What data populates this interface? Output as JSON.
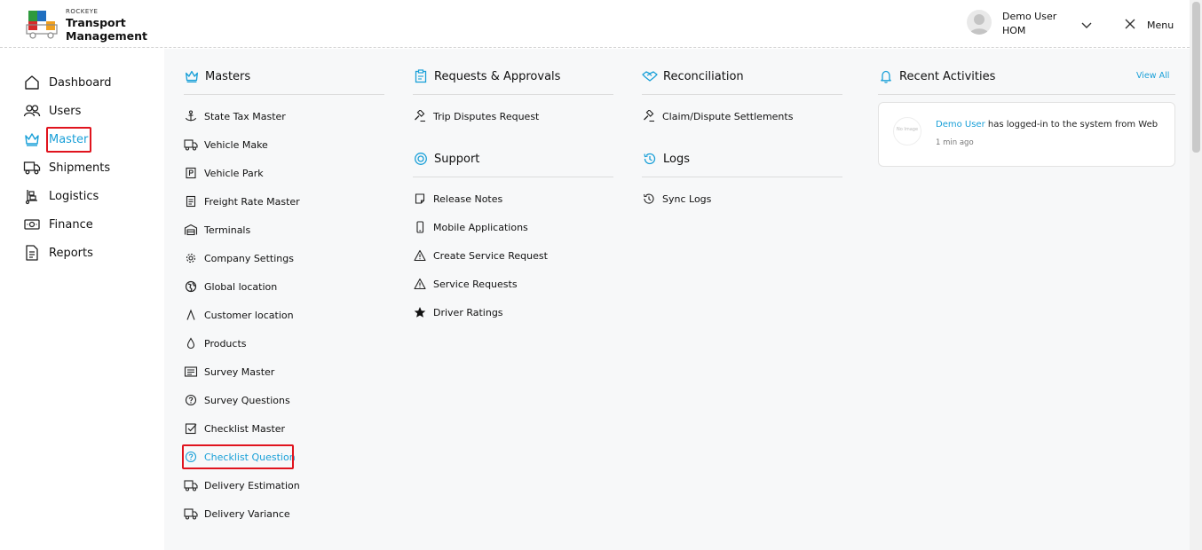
{
  "header": {
    "brand_small": "ROCKEYE",
    "brand_line1": "Transport",
    "brand_line2": "Management",
    "user_name": "Demo User",
    "user_org": "HOM",
    "menu_label": "Menu"
  },
  "sidebar": {
    "items": [
      {
        "label": "Dashboard",
        "icon": "home-icon"
      },
      {
        "label": "Users",
        "icon": "users-icon"
      },
      {
        "label": "Master",
        "icon": "crown-icon"
      },
      {
        "label": "Shipments",
        "icon": "truck-icon"
      },
      {
        "label": "Logistics",
        "icon": "logistics-icon"
      },
      {
        "label": "Finance",
        "icon": "money-icon"
      },
      {
        "label": "Reports",
        "icon": "report-icon"
      }
    ]
  },
  "masters": {
    "title": "Masters",
    "items": [
      {
        "label": "State Tax Master",
        "icon": "anchor-icon"
      },
      {
        "label": "Vehicle Make",
        "icon": "truck-icon"
      },
      {
        "label": "Vehicle Park",
        "icon": "parking-icon"
      },
      {
        "label": "Freight Rate Master",
        "icon": "document-icon"
      },
      {
        "label": "Terminals",
        "icon": "garage-icon"
      },
      {
        "label": "Company Settings",
        "icon": "gear-icon"
      },
      {
        "label": "Global location",
        "icon": "globe-icon"
      },
      {
        "label": "Customer location",
        "icon": "pin-icon"
      },
      {
        "label": "Products",
        "icon": "drop-icon"
      },
      {
        "label": "Survey Master",
        "icon": "survey-icon"
      },
      {
        "label": "Survey Questions",
        "icon": "question-icon"
      },
      {
        "label": "Checklist Master",
        "icon": "checkbox-icon"
      },
      {
        "label": "Checklist Question",
        "icon": "question-icon"
      },
      {
        "label": "Delivery Estimation",
        "icon": "truck-icon"
      },
      {
        "label": "Delivery Variance",
        "icon": "truck-icon"
      }
    ]
  },
  "requests": {
    "title": "Requests & Approvals",
    "items": [
      {
        "label": "Trip Disputes Request",
        "icon": "gavel-icon"
      }
    ]
  },
  "support": {
    "title": "Support",
    "items": [
      {
        "label": "Release Notes",
        "icon": "note-icon"
      },
      {
        "label": "Mobile Applications",
        "icon": "mobile-icon"
      },
      {
        "label": "Create Service Request",
        "icon": "warning-icon"
      },
      {
        "label": "Service Requests",
        "icon": "warning-icon"
      },
      {
        "label": "Driver Ratings",
        "icon": "star-icon"
      }
    ]
  },
  "reconciliation": {
    "title": "Reconciliation",
    "items": [
      {
        "label": "Claim/Dispute Settlements",
        "icon": "gavel-icon"
      }
    ]
  },
  "logs": {
    "title": "Logs",
    "items": [
      {
        "label": "Sync Logs",
        "icon": "history-icon"
      }
    ]
  },
  "activities": {
    "title": "Recent Activities",
    "view_all": "View All",
    "no_image": "No Image",
    "entry_user": "Demo User",
    "entry_text": " has logged-in to the system from Web",
    "entry_time": "1 min ago"
  },
  "colors": {
    "accent": "#1aa0d8",
    "highlight": "#e0141e"
  }
}
